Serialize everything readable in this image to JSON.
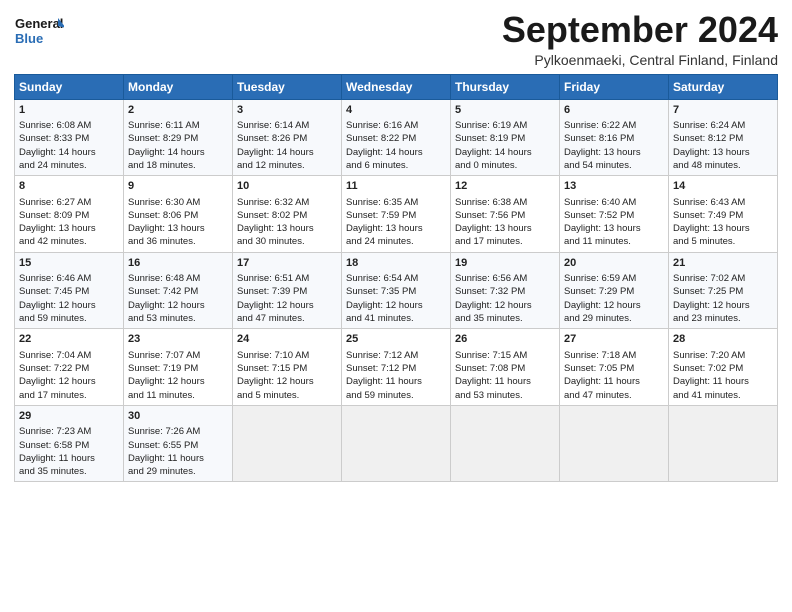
{
  "logo": {
    "line1": "General",
    "line2": "Blue"
  },
  "title": "September 2024",
  "location": "Pylkoenmaeki, Central Finland, Finland",
  "days_header": [
    "Sunday",
    "Monday",
    "Tuesday",
    "Wednesday",
    "Thursday",
    "Friday",
    "Saturday"
  ],
  "weeks": [
    [
      {
        "day": "1",
        "lines": [
          "Sunrise: 6:08 AM",
          "Sunset: 8:33 PM",
          "Daylight: 14 hours",
          "and 24 minutes."
        ]
      },
      {
        "day": "2",
        "lines": [
          "Sunrise: 6:11 AM",
          "Sunset: 8:29 PM",
          "Daylight: 14 hours",
          "and 18 minutes."
        ]
      },
      {
        "day": "3",
        "lines": [
          "Sunrise: 6:14 AM",
          "Sunset: 8:26 PM",
          "Daylight: 14 hours",
          "and 12 minutes."
        ]
      },
      {
        "day": "4",
        "lines": [
          "Sunrise: 6:16 AM",
          "Sunset: 8:22 PM",
          "Daylight: 14 hours",
          "and 6 minutes."
        ]
      },
      {
        "day": "5",
        "lines": [
          "Sunrise: 6:19 AM",
          "Sunset: 8:19 PM",
          "Daylight: 14 hours",
          "and 0 minutes."
        ]
      },
      {
        "day": "6",
        "lines": [
          "Sunrise: 6:22 AM",
          "Sunset: 8:16 PM",
          "Daylight: 13 hours",
          "and 54 minutes."
        ]
      },
      {
        "day": "7",
        "lines": [
          "Sunrise: 6:24 AM",
          "Sunset: 8:12 PM",
          "Daylight: 13 hours",
          "and 48 minutes."
        ]
      }
    ],
    [
      {
        "day": "8",
        "lines": [
          "Sunrise: 6:27 AM",
          "Sunset: 8:09 PM",
          "Daylight: 13 hours",
          "and 42 minutes."
        ]
      },
      {
        "day": "9",
        "lines": [
          "Sunrise: 6:30 AM",
          "Sunset: 8:06 PM",
          "Daylight: 13 hours",
          "and 36 minutes."
        ]
      },
      {
        "day": "10",
        "lines": [
          "Sunrise: 6:32 AM",
          "Sunset: 8:02 PM",
          "Daylight: 13 hours",
          "and 30 minutes."
        ]
      },
      {
        "day": "11",
        "lines": [
          "Sunrise: 6:35 AM",
          "Sunset: 7:59 PM",
          "Daylight: 13 hours",
          "and 24 minutes."
        ]
      },
      {
        "day": "12",
        "lines": [
          "Sunrise: 6:38 AM",
          "Sunset: 7:56 PM",
          "Daylight: 13 hours",
          "and 17 minutes."
        ]
      },
      {
        "day": "13",
        "lines": [
          "Sunrise: 6:40 AM",
          "Sunset: 7:52 PM",
          "Daylight: 13 hours",
          "and 11 minutes."
        ]
      },
      {
        "day": "14",
        "lines": [
          "Sunrise: 6:43 AM",
          "Sunset: 7:49 PM",
          "Daylight: 13 hours",
          "and 5 minutes."
        ]
      }
    ],
    [
      {
        "day": "15",
        "lines": [
          "Sunrise: 6:46 AM",
          "Sunset: 7:45 PM",
          "Daylight: 12 hours",
          "and 59 minutes."
        ]
      },
      {
        "day": "16",
        "lines": [
          "Sunrise: 6:48 AM",
          "Sunset: 7:42 PM",
          "Daylight: 12 hours",
          "and 53 minutes."
        ]
      },
      {
        "day": "17",
        "lines": [
          "Sunrise: 6:51 AM",
          "Sunset: 7:39 PM",
          "Daylight: 12 hours",
          "and 47 minutes."
        ]
      },
      {
        "day": "18",
        "lines": [
          "Sunrise: 6:54 AM",
          "Sunset: 7:35 PM",
          "Daylight: 12 hours",
          "and 41 minutes."
        ]
      },
      {
        "day": "19",
        "lines": [
          "Sunrise: 6:56 AM",
          "Sunset: 7:32 PM",
          "Daylight: 12 hours",
          "and 35 minutes."
        ]
      },
      {
        "day": "20",
        "lines": [
          "Sunrise: 6:59 AM",
          "Sunset: 7:29 PM",
          "Daylight: 12 hours",
          "and 29 minutes."
        ]
      },
      {
        "day": "21",
        "lines": [
          "Sunrise: 7:02 AM",
          "Sunset: 7:25 PM",
          "Daylight: 12 hours",
          "and 23 minutes."
        ]
      }
    ],
    [
      {
        "day": "22",
        "lines": [
          "Sunrise: 7:04 AM",
          "Sunset: 7:22 PM",
          "Daylight: 12 hours",
          "and 17 minutes."
        ]
      },
      {
        "day": "23",
        "lines": [
          "Sunrise: 7:07 AM",
          "Sunset: 7:19 PM",
          "Daylight: 12 hours",
          "and 11 minutes."
        ]
      },
      {
        "day": "24",
        "lines": [
          "Sunrise: 7:10 AM",
          "Sunset: 7:15 PM",
          "Daylight: 12 hours",
          "and 5 minutes."
        ]
      },
      {
        "day": "25",
        "lines": [
          "Sunrise: 7:12 AM",
          "Sunset: 7:12 PM",
          "Daylight: 11 hours",
          "and 59 minutes."
        ]
      },
      {
        "day": "26",
        "lines": [
          "Sunrise: 7:15 AM",
          "Sunset: 7:08 PM",
          "Daylight: 11 hours",
          "and 53 minutes."
        ]
      },
      {
        "day": "27",
        "lines": [
          "Sunrise: 7:18 AM",
          "Sunset: 7:05 PM",
          "Daylight: 11 hours",
          "and 47 minutes."
        ]
      },
      {
        "day": "28",
        "lines": [
          "Sunrise: 7:20 AM",
          "Sunset: 7:02 PM",
          "Daylight: 11 hours",
          "and 41 minutes."
        ]
      }
    ],
    [
      {
        "day": "29",
        "lines": [
          "Sunrise: 7:23 AM",
          "Sunset: 6:58 PM",
          "Daylight: 11 hours",
          "and 35 minutes."
        ]
      },
      {
        "day": "30",
        "lines": [
          "Sunrise: 7:26 AM",
          "Sunset: 6:55 PM",
          "Daylight: 11 hours",
          "and 29 minutes."
        ]
      },
      {
        "day": "",
        "lines": []
      },
      {
        "day": "",
        "lines": []
      },
      {
        "day": "",
        "lines": []
      },
      {
        "day": "",
        "lines": []
      },
      {
        "day": "",
        "lines": []
      }
    ]
  ]
}
